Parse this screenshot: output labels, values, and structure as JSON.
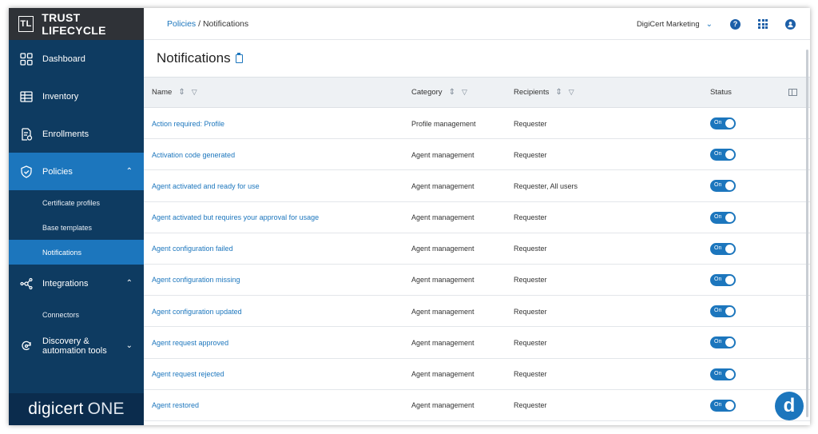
{
  "brand": {
    "logo": "TL",
    "name": "TRUST LIFECYCLE"
  },
  "sidebar": {
    "items": [
      {
        "label": "Dashboard",
        "icon": "dashboard-icon"
      },
      {
        "label": "Inventory",
        "icon": "table-icon"
      },
      {
        "label": "Enrollments",
        "icon": "enrollment-icon"
      },
      {
        "label": "Policies",
        "icon": "shield-check-icon",
        "expanded": true
      },
      {
        "label": "Integrations",
        "icon": "integrations-icon",
        "expanded": true
      },
      {
        "label": "Discovery &",
        "label2": "automation tools",
        "icon": "discovery-icon",
        "expanded": false
      }
    ],
    "policies_sub": [
      "Certificate profiles",
      "Base templates",
      "Notifications"
    ],
    "integrations_sub": [
      "Connectors"
    ],
    "footer_logo": "digicert",
    "footer_suffix": "ONE"
  },
  "topbar": {
    "breadcrumb_link": "Policies",
    "breadcrumb_sep": " / ",
    "breadcrumb_current": "Notifications",
    "org": "DigiCert Marketing",
    "help_icon": "?",
    "account_icon": "user-icon"
  },
  "page": {
    "title": "Notifications"
  },
  "table": {
    "columns": {
      "name": "Name",
      "category": "Category",
      "recipients": "Recipients",
      "status": "Status"
    },
    "rows": [
      {
        "name": "Action required: Profile",
        "category": "Profile management",
        "recipients": "Requester",
        "status": "On"
      },
      {
        "name": "Activation code generated",
        "category": "Agent management",
        "recipients": "Requester",
        "status": "On"
      },
      {
        "name": "Agent activated and ready for use",
        "category": "Agent management",
        "recipients": "Requester, All users",
        "status": "On"
      },
      {
        "name": "Agent activated but requires your approval for usage",
        "category": "Agent management",
        "recipients": "Requester",
        "status": "On"
      },
      {
        "name": "Agent configuration failed",
        "category": "Agent management",
        "recipients": "Requester",
        "status": "On"
      },
      {
        "name": "Agent configuration missing",
        "category": "Agent management",
        "recipients": "Requester",
        "status": "On"
      },
      {
        "name": "Agent configuration updated",
        "category": "Agent management",
        "recipients": "Requester",
        "status": "On"
      },
      {
        "name": "Agent request approved",
        "category": "Agent management",
        "recipients": "Requester",
        "status": "On"
      },
      {
        "name": "Agent request rejected",
        "category": "Agent management",
        "recipients": "Requester",
        "status": "On"
      },
      {
        "name": "Agent restored",
        "category": "Agent management",
        "recipients": "Requester",
        "status": "On"
      }
    ]
  },
  "fab": {
    "label": "d"
  },
  "colors": {
    "sidebar": "#0e3b61",
    "accent": "#1c76bd",
    "brand_bar": "#2f3237"
  }
}
